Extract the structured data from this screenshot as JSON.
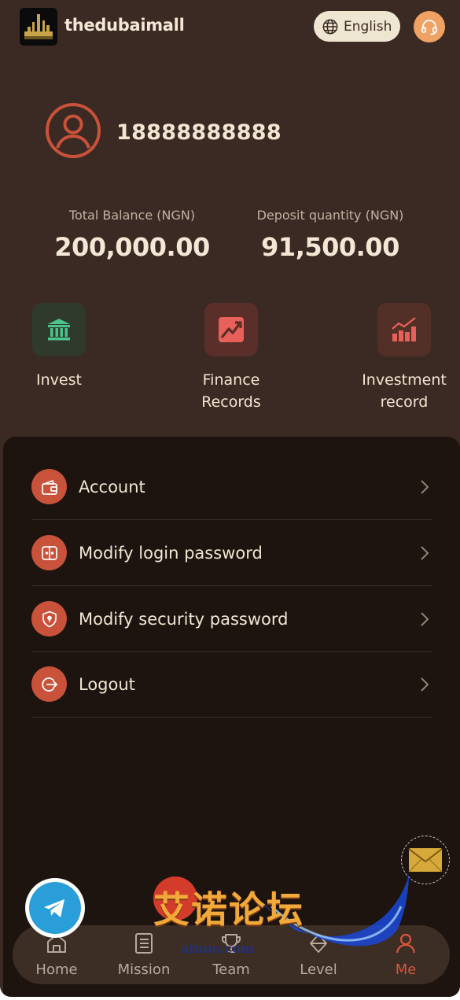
{
  "header": {
    "brand": "thedubaimall",
    "language": "English"
  },
  "profile": {
    "phone": "18888888888"
  },
  "stats": [
    {
      "label": "Total Balance (NGN)",
      "value": "200,000.00"
    },
    {
      "label": "Deposit quantity (NGN)",
      "value": "91,500.00"
    }
  ],
  "quick_actions": [
    {
      "label": "Invest",
      "icon": "bank-icon"
    },
    {
      "label": "Finance Records",
      "icon": "trend-up-icon"
    },
    {
      "label": "Investment record",
      "icon": "bar-chart-icon"
    }
  ],
  "menu": [
    {
      "label": "Account",
      "icon": "wallet-icon"
    },
    {
      "label": "Modify login password",
      "icon": "split-panel-icon"
    },
    {
      "label": "Modify security password",
      "icon": "shield-lock-icon"
    },
    {
      "label": "Logout",
      "icon": "logout-icon"
    }
  ],
  "nav": [
    {
      "label": "Home",
      "icon": "home-icon"
    },
    {
      "label": "Mission",
      "icon": "list-icon"
    },
    {
      "label": "Team",
      "icon": "trophy-icon"
    },
    {
      "label": "Level",
      "icon": "level-icon"
    },
    {
      "label": "Me",
      "icon": "user-icon",
      "active": true
    }
  ],
  "watermark": {
    "zh": "艾诺论坛",
    "en": "ainuo.com"
  },
  "colors": {
    "background": "#3b2a23",
    "panel": "#1d1410",
    "accent": "#c8523a",
    "active_nav": "#d8573c"
  }
}
